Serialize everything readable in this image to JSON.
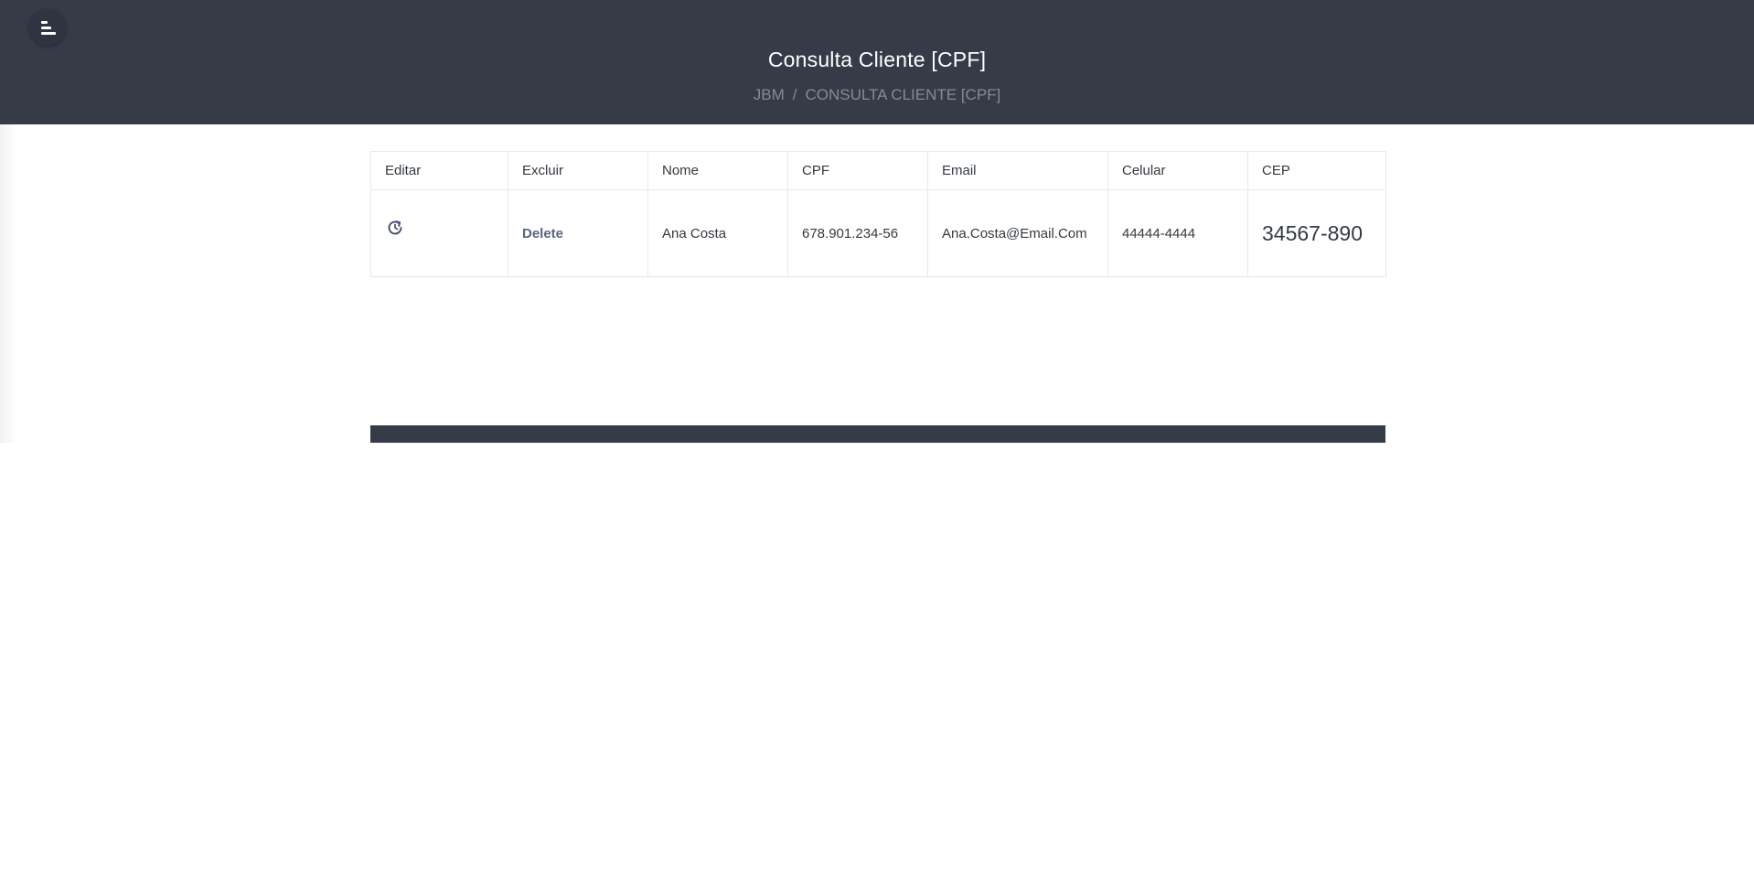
{
  "header": {
    "title": "Consulta Cliente [CPF]",
    "breadcrumb": {
      "root": "JBM",
      "separator": "/",
      "current": "CONSULTA CLIENTE [CPF]"
    },
    "menu_icon": "menu-align-left-icon"
  },
  "table": {
    "columns": [
      "Editar",
      "Excluir",
      "Nome",
      "CPF",
      "Email",
      "Celular",
      "CEP"
    ],
    "rows": [
      {
        "edit_icon": "refresh-edit-icon",
        "delete_label": "Delete",
        "nome": "Ana Costa",
        "cpf": "678.901.234-56",
        "email": "Ana.Costa@Email.Com",
        "celular": "44444-4444",
        "cep": "34567-890"
      }
    ]
  },
  "colors": {
    "header_bg": "#363b48",
    "accent": "#5a6583",
    "text": "#343a40",
    "breadcrumb": "#858a96"
  }
}
